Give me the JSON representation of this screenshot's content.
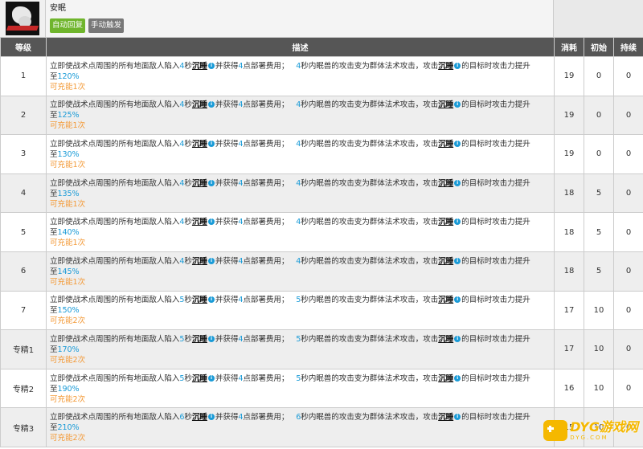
{
  "skill": {
    "icon": "sleep-skill-icon",
    "name": "安眠",
    "tag_auto": "自动回复",
    "tag_manual": "手动触发"
  },
  "table": {
    "headers": {
      "level": "等级",
      "desc": "描述",
      "cost": "消耗",
      "init": "初始",
      "duration": "持续"
    },
    "desc_parts": {
      "p1": "立即使战术点周围的所有地面敌人陷入",
      "p2": "秒",
      "term": "沉睡",
      "p3": "并获得",
      "p4": "点部署费用；",
      "p5": "秒内眠兽的攻击变为群体法术攻击，攻击",
      "p6": "的目标时攻击力提升",
      "p7": "至"
    },
    "rows": [
      {
        "level": "1",
        "sleep_sec": "4",
        "dp": "4",
        "dur_sec": "4",
        "atk": "120%",
        "charges": "可充能1次",
        "cost": "19",
        "init": "0",
        "duration": "0"
      },
      {
        "level": "2",
        "sleep_sec": "4",
        "dp": "4",
        "dur_sec": "4",
        "atk": "125%",
        "charges": "可充能1次",
        "cost": "19",
        "init": "0",
        "duration": "0"
      },
      {
        "level": "3",
        "sleep_sec": "4",
        "dp": "4",
        "dur_sec": "4",
        "atk": "130%",
        "charges": "可充能1次",
        "cost": "19",
        "init": "0",
        "duration": "0"
      },
      {
        "level": "4",
        "sleep_sec": "4",
        "dp": "4",
        "dur_sec": "4",
        "atk": "135%",
        "charges": "可充能1次",
        "cost": "18",
        "init": "5",
        "duration": "0"
      },
      {
        "level": "5",
        "sleep_sec": "4",
        "dp": "4",
        "dur_sec": "4",
        "atk": "140%",
        "charges": "可充能1次",
        "cost": "18",
        "init": "5",
        "duration": "0"
      },
      {
        "level": "6",
        "sleep_sec": "4",
        "dp": "4",
        "dur_sec": "4",
        "atk": "145%",
        "charges": "可充能1次",
        "cost": "18",
        "init": "5",
        "duration": "0"
      },
      {
        "level": "7",
        "sleep_sec": "5",
        "dp": "4",
        "dur_sec": "5",
        "atk": "150%",
        "charges": "可充能2次",
        "cost": "17",
        "init": "10",
        "duration": "0"
      },
      {
        "level": "专精1",
        "sleep_sec": "5",
        "dp": "4",
        "dur_sec": "5",
        "atk": "170%",
        "charges": "可充能2次",
        "cost": "17",
        "init": "10",
        "duration": "0"
      },
      {
        "level": "专精2",
        "sleep_sec": "5",
        "dp": "4",
        "dur_sec": "5",
        "atk": "190%",
        "charges": "可充能2次",
        "cost": "16",
        "init": "10",
        "duration": "0"
      },
      {
        "level": "专精3",
        "sleep_sec": "6",
        "dp": "4",
        "dur_sec": "6",
        "atk": "210%",
        "charges": "可充能2次",
        "cost": "15",
        "init": "10",
        "duration": "0"
      }
    ]
  },
  "watermark": {
    "main": "DYG游戏网",
    "sub": "DYG.COM"
  },
  "colors": {
    "highlight_blue": "#1a9bd7",
    "highlight_orange": "#f39a38",
    "header_bg": "#565656",
    "tag_auto_bg": "#6fb52c",
    "tag_manual_bg": "#777777"
  }
}
